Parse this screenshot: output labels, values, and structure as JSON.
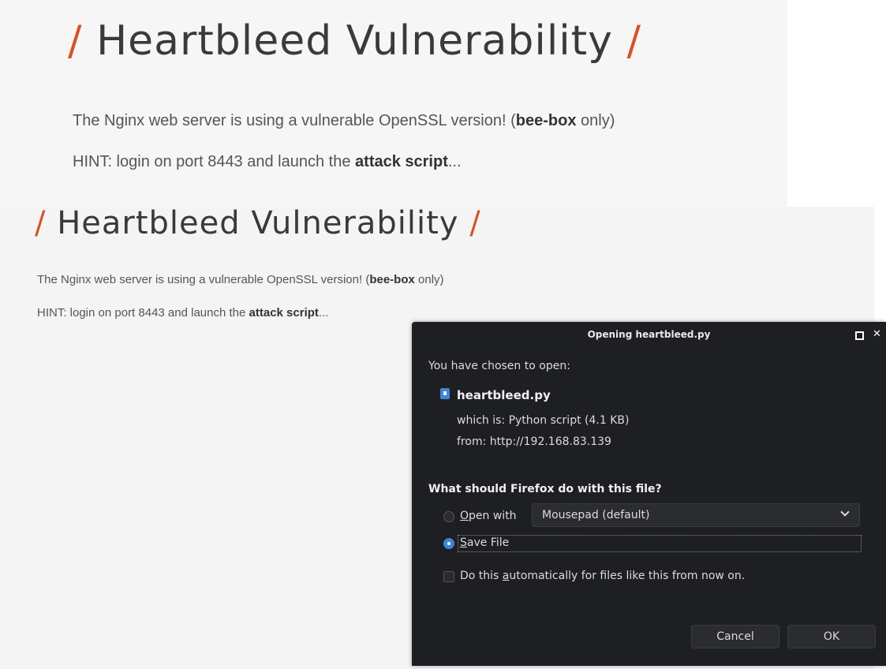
{
  "page": {
    "heading": "Heartbleed Vulnerability",
    "slash": "/",
    "para1": {
      "prefix": "The Nginx web server is using a vulnerable OpenSSL version! (",
      "bold": "bee-box",
      "suffix": " only)"
    },
    "para2": {
      "prefix": "HINT: login on port 8443 and launch the ",
      "bold": "attack script",
      "suffix": "..."
    }
  },
  "dialog": {
    "title": "Opening heartbleed.py",
    "intro": "You have chosen to open:",
    "filename": "heartbleed.py",
    "which_is": "which is: Python script (4.1 KB)",
    "from": "from: http://192.168.83.139",
    "question": "What should Firefox do with this file?",
    "open_with": {
      "mnemonic": "O",
      "rest": "pen with",
      "selected": false
    },
    "app_select": "Mousepad (default)",
    "save_file": {
      "mnemonic": "S",
      "rest": "ave File",
      "selected": true
    },
    "auto_checkbox": {
      "pre": "Do this ",
      "mnemonic": "a",
      "rest": "utomatically for files like this from now on.",
      "checked": false
    },
    "cancel_label": "Cancel",
    "ok_label": "OK",
    "colors": {
      "background": "#1e1f23",
      "accent": "#3d86d6",
      "slash": "#d2552b"
    }
  }
}
